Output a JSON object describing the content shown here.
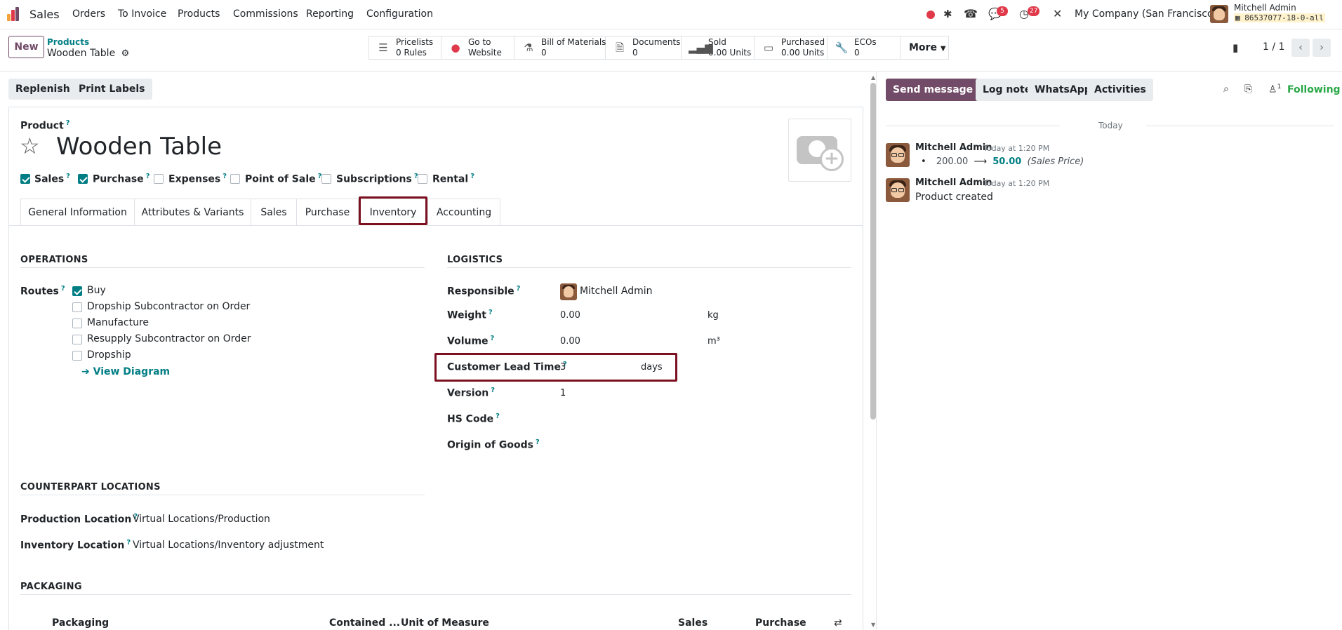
{
  "nav": {
    "app": "Sales",
    "menus": [
      "Orders",
      "To Invoice",
      "Products",
      "Commissions",
      "Reporting",
      "Configuration"
    ],
    "messages_badge": "5",
    "activities_badge": "27",
    "company": "My Company (San Francisco)",
    "user_name": "Mitchell Admin",
    "db_name": "86537077-18-0-all"
  },
  "control": {
    "new_label": "New",
    "breadcrumb_parent": "Products",
    "breadcrumb_current": "Wooden Table",
    "pager": "1 / 1",
    "smart_buttons": [
      {
        "line1": "Pricelists",
        "line2": "0 Rules",
        "icon": "list-icon"
      },
      {
        "line1": "Go to",
        "line2": "Website",
        "icon": "globe-icon"
      },
      {
        "line1": "Bill of Materials",
        "line2": "0",
        "icon": "flask-icon"
      },
      {
        "line1": "Documents",
        "line2": "0",
        "icon": "document-icon"
      },
      {
        "line1": "Sold",
        "line2": "0.00 Units",
        "icon": "signal-icon"
      },
      {
        "line1": "Purchased",
        "line2": "0.00 Units",
        "icon": "credit-card-icon"
      },
      {
        "line1": "ECOs",
        "line2": "0",
        "icon": "wrench-icon"
      }
    ],
    "more_label": "More"
  },
  "actions": {
    "replenish": "Replenish",
    "print_labels": "Print Labels"
  },
  "product": {
    "label": "Product",
    "name": "Wooden Table",
    "flags": [
      {
        "label": "Sales",
        "checked": true
      },
      {
        "label": "Purchase",
        "checked": true
      },
      {
        "label": "Expenses",
        "checked": false
      },
      {
        "label": "Point of Sale",
        "checked": false
      },
      {
        "label": "Subscriptions",
        "checked": false
      },
      {
        "label": "Rental",
        "checked": false
      }
    ]
  },
  "tabs": [
    "General Information",
    "Attributes & Variants",
    "Sales",
    "Purchase",
    "Inventory",
    "Accounting"
  ],
  "operations": {
    "title": "OPERATIONS",
    "routes_label": "Routes",
    "routes": [
      {
        "label": "Buy",
        "checked": true
      },
      {
        "label": "Dropship Subcontractor on Order",
        "checked": false
      },
      {
        "label": "Manufacture",
        "checked": false
      },
      {
        "label": "Resupply Subcontractor on Order",
        "checked": false
      },
      {
        "label": "Dropship",
        "checked": false
      }
    ],
    "view_diagram": "View Diagram"
  },
  "logistics": {
    "title": "LOGISTICS",
    "responsible_label": "Responsible",
    "responsible": "Mitchell Admin",
    "weight_label": "Weight",
    "weight": "0.00",
    "weight_unit": "kg",
    "volume_label": "Volume",
    "volume": "0.00",
    "volume_unit": "m³",
    "lead_time_label": "Customer Lead Time",
    "lead_time": "3",
    "lead_time_unit": "days",
    "version_label": "Version",
    "version": "1",
    "hs_code_label": "HS Code",
    "origin_label": "Origin of Goods"
  },
  "counterpart": {
    "title": "COUNTERPART LOCATIONS",
    "production_label": "Production Location",
    "production": "Virtual Locations/Production",
    "inventory_label": "Inventory Location",
    "inventory": "Virtual Locations/Inventory adjustment"
  },
  "packaging": {
    "title": "PACKAGING",
    "columns": [
      "Packaging",
      "Contained ...",
      "Unit of Measure",
      "Sales",
      "Purchase"
    ]
  },
  "chatter": {
    "send_message": "Send message",
    "log_note": "Log note",
    "whatsapp": "WhatsApp",
    "activities": "Activities",
    "followers_count": "1",
    "following": "Following",
    "date_sep": "Today",
    "messages": [
      {
        "author": "Mitchell Admin",
        "time": "Today at 1:20 PM",
        "old": "200.00",
        "new": "50.00",
        "field": "(Sales Price)"
      },
      {
        "author": "Mitchell Admin",
        "time": "Today at 1:20 PM",
        "body": "Product created"
      }
    ]
  },
  "colors": {
    "brand": "#714b67",
    "link": "#017e84",
    "highlight": "#7b1120"
  }
}
